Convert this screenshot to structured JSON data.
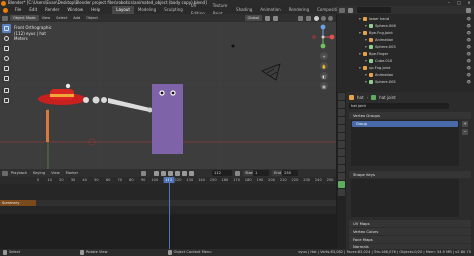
{
  "window": {
    "title": "Blender* [C:\\Users\\Evan\\Desktop\\Blender project files\\robotics\\animated_object (body copy).blend]",
    "minimize_icon": "minimize-icon",
    "maximize_icon": "maximize-icon",
    "close_icon": "close-icon"
  },
  "menubar": {
    "menus": [
      "File",
      "Edit",
      "Render",
      "Window",
      "Help"
    ],
    "workspaces": [
      "Layout",
      "Modeling",
      "Sculpting",
      "UV Editing",
      "Texture Paint",
      "Shading",
      "Animation",
      "Rendering",
      "Compositing",
      "Scripting"
    ],
    "active_workspace": "Layout",
    "scene_label": "Scene",
    "view_layer_label": "View Layer"
  },
  "viewport": {
    "mode": "Object Mode",
    "menus": [
      "View",
      "Select",
      "Add",
      "Object"
    ],
    "shading_label": "Global",
    "info_view": "Front Orthographic",
    "info_object": "(112) eyus | hat",
    "info_units": "Meters",
    "accent": "#5680c2"
  },
  "timeline": {
    "menus": [
      "Playback",
      "Keying",
      "View",
      "Marker"
    ],
    "current_frame": "112",
    "start_label": "Start",
    "start_value": "1",
    "end_label": "End",
    "end_value": "250",
    "ticks": [
      "0",
      "10",
      "20",
      "30",
      "40",
      "50",
      "60",
      "70",
      "80",
      "90",
      "100",
      "110",
      "120",
      "130",
      "140",
      "150",
      "160",
      "170",
      "180",
      "190",
      "200",
      "210",
      "220",
      "230",
      "240",
      "250"
    ],
    "summary": "Summary"
  },
  "outliner": {
    "rows": [
      {
        "label": "lower hand",
        "indent": 3,
        "color": "#e8a24a"
      },
      {
        "label": "Sphera.006",
        "indent": 4,
        "color": "#8fcf8f"
      },
      {
        "label": "Bpe.Fng.Joint",
        "indent": 3,
        "color": "#e8a24a"
      },
      {
        "label": "Animation",
        "indent": 4,
        "color": "#e8a24a"
      },
      {
        "label": "Sphere.003",
        "indent": 4,
        "color": "#8fcf8f"
      },
      {
        "label": "Bpe.Finger",
        "indent": 3,
        "color": "#e8a24a"
      },
      {
        "label": "Cube.010",
        "indent": 4,
        "color": "#8fcf8f"
      },
      {
        "label": "up.Fng.joint",
        "indent": 3,
        "color": "#e8a24a"
      },
      {
        "label": "Animation",
        "indent": 4,
        "color": "#e8a24a"
      },
      {
        "label": "Sphere.005",
        "indent": 4,
        "color": "#8fcf8f"
      }
    ]
  },
  "properties": {
    "object_name": "hat",
    "data_name": "hat joint",
    "vertex_groups_title": "Vertex Groups",
    "vertex_group_item": "Group",
    "shape_keys_title": "Shape Keys",
    "uv_maps_title": "UV Maps",
    "vertex_colors_title": "Vertex Colors",
    "face_maps_title": "Face Maps",
    "normals_title": "Normals"
  },
  "statusbar": {
    "select": "Select",
    "rotate_view": "Rotate View",
    "context_menu": "Object Context Menu",
    "stats": "eyus | Hat | Verts:83,082 | Faces:83,024 | Tris:166,076 | Objects:0/20 | Mem: 54.9 MB | v2.80.75"
  }
}
